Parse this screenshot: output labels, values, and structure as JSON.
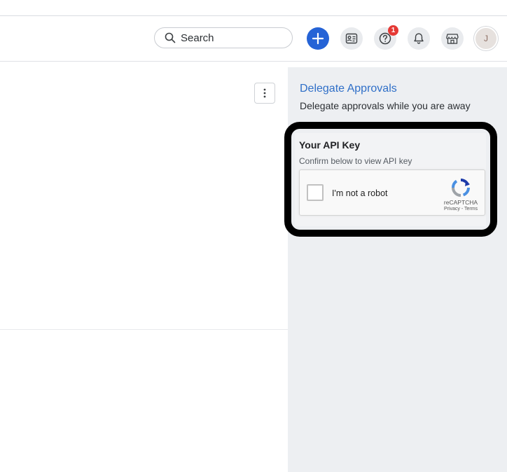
{
  "header": {
    "search": {
      "placeholder": "Search",
      "icon": "search-icon"
    },
    "buttons": {
      "create": {
        "icon": "plus-icon",
        "color": "#2563d6"
      },
      "directory": {
        "icon": "id-card-icon"
      },
      "help": {
        "icon": "question-icon",
        "badge": "1"
      },
      "notifications": {
        "icon": "bell-icon"
      },
      "store": {
        "icon": "storefront-icon"
      }
    },
    "avatar": {
      "initial": "J"
    }
  },
  "main": {
    "menu_button": {
      "icon": "vertical-ellipsis-icon"
    }
  },
  "sidebar": {
    "delegate": {
      "title": "Delegate Approvals",
      "description": "Delegate approvals while you are away"
    },
    "api_key": {
      "title": "Your API Key",
      "subtitle": "Confirm below to view API key",
      "captcha": {
        "label": "I'm not a robot",
        "brand": "reCAPTCHA",
        "privacy": "Privacy",
        "separator": " - ",
        "terms": "Terms"
      }
    }
  },
  "colors": {
    "accent": "#2563d6",
    "link": "#2f6fc8",
    "badge": "#e53935",
    "sidebar_bg": "#edeff2",
    "highlight": "#000000"
  }
}
